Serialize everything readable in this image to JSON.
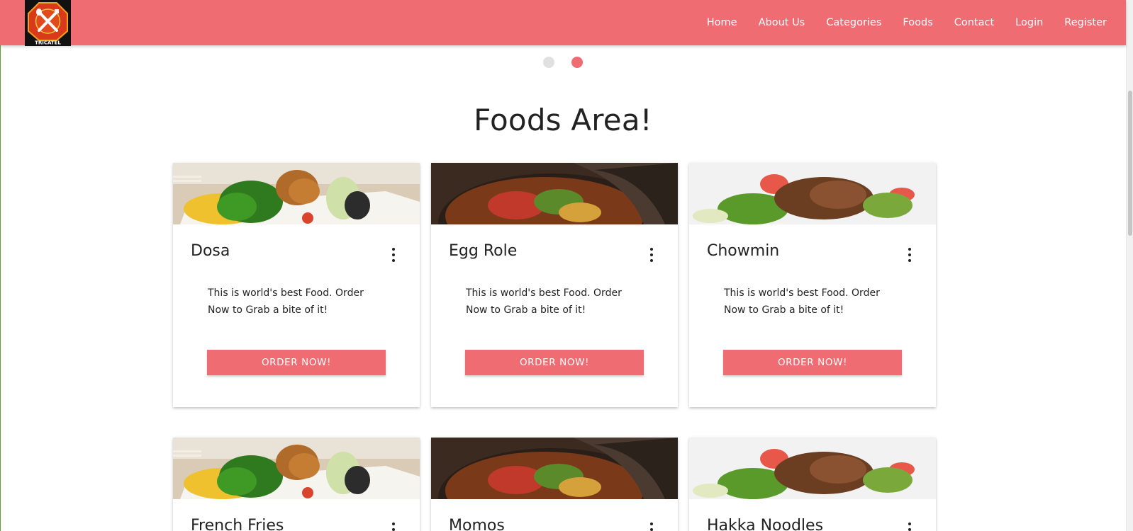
{
  "brand": {
    "logo_text": "TRICATEL",
    "logo_icon": "fork-knife-crest-icon"
  },
  "nav": {
    "items": [
      {
        "label": "Home"
      },
      {
        "label": "About Us"
      },
      {
        "label": "Categories"
      },
      {
        "label": "Foods"
      },
      {
        "label": "Contact"
      },
      {
        "label": "Login"
      },
      {
        "label": "Register"
      }
    ]
  },
  "carousel": {
    "dot_count": 2,
    "active_index": 1
  },
  "section": {
    "heading": "Foods Area!"
  },
  "foods": [
    {
      "name": "Dosa",
      "description": "This is world's best Food. Order Now to Grab a bite of it!",
      "button": "Order Now!",
      "image": "bento-plate"
    },
    {
      "name": "Egg Role",
      "description": "This is world's best Food. Order Now to Grab a bite of it!",
      "button": "Order Now!",
      "image": "stir-fry-pot"
    },
    {
      "name": "Chowmin",
      "description": "This is world's best Food. Order Now to Grab a bite of it!",
      "button": "Order Now!",
      "image": "beef-salad"
    },
    {
      "name": "French Fries",
      "image": "bento-plate"
    },
    {
      "name": "Momos",
      "image": "stir-fry-pot"
    },
    {
      "name": "Hakka Noodles",
      "image": "beef-salad"
    }
  ],
  "colors": {
    "accent": "#ef6c73",
    "navbar": "#ef6c73",
    "dot_inactive": "#e0e0e0"
  }
}
